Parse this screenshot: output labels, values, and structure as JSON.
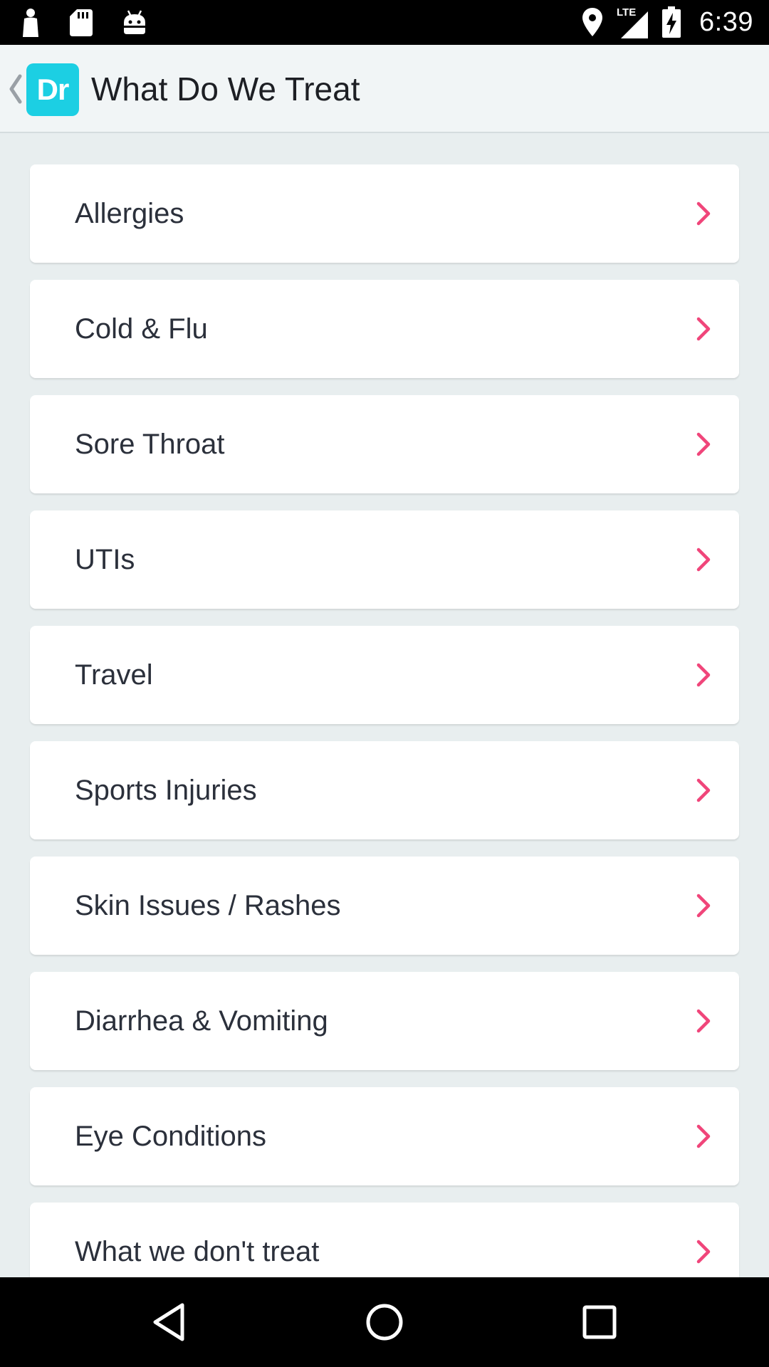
{
  "status_bar": {
    "time": "6:39",
    "network": "LTE",
    "left_icons": [
      "person-icon",
      "sd-card-icon",
      "android-icon"
    ],
    "right_icons": [
      "location-icon",
      "signal-icon",
      "battery-charging-icon"
    ]
  },
  "app_bar": {
    "logo_text": "Dr",
    "title": "What Do We Treat",
    "logo_color": "#1ccfe3"
  },
  "list": {
    "accent_color": "#f0457a",
    "items": [
      {
        "label": "Allergies"
      },
      {
        "label": "Cold & Flu"
      },
      {
        "label": "Sore Throat"
      },
      {
        "label": "UTIs"
      },
      {
        "label": "Travel"
      },
      {
        "label": "Sports Injuries"
      },
      {
        "label": "Skin Issues / Rashes"
      },
      {
        "label": "Diarrhea & Vomiting"
      },
      {
        "label": "Eye Conditions"
      },
      {
        "label": "What we don't treat"
      }
    ]
  },
  "nav_bar": {
    "buttons": [
      "back-icon",
      "home-icon",
      "recents-icon"
    ]
  }
}
